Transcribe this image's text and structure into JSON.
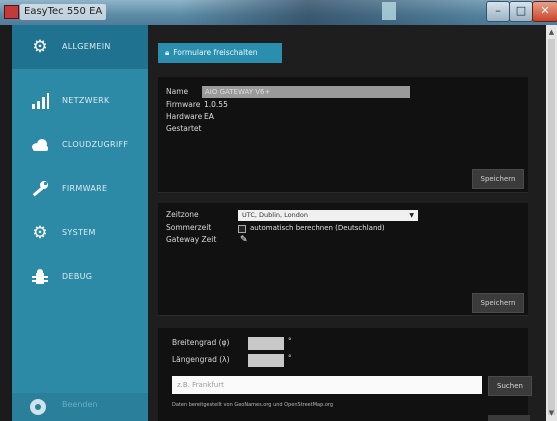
{
  "window": {
    "title": "EasyTec 550 EA"
  },
  "sidebar": {
    "items": [
      {
        "label": "ALLGEMEIN",
        "icon": "gear-icon"
      },
      {
        "label": "NETZWERK",
        "icon": "signal-icon"
      },
      {
        "label": "CLOUDZUGRIFF",
        "icon": "cloud-icon"
      },
      {
        "label": "FIRMWARE",
        "icon": "wrench-icon"
      },
      {
        "label": "SYSTEM",
        "icon": "gear-icon"
      },
      {
        "label": "DEBUG",
        "icon": "debug-icon"
      }
    ],
    "bottom_label": "Beenden"
  },
  "main": {
    "lock_button": "Formulare freischalten",
    "device": {
      "name_label": "Name",
      "name_value": "AIO GATEWAY V6+",
      "firmware_label": "Firmware",
      "firmware_value": "1.0.55",
      "hardware_label": "Hardware",
      "hardware_value": "EA",
      "started_label": "Gestartet",
      "save": "Speichern"
    },
    "time": {
      "timezone_label": "Zeitzone",
      "timezone_value": "UTC, Dublin, London",
      "dst_label": "Sommerzeit",
      "dst_option": "automatisch berechnen (Deutschland)",
      "gateway_time_label": "Gateway Zeit",
      "save": "Speichern"
    },
    "location": {
      "lat_label": "Breitengrad (φ)",
      "lon_label": "Längengrad (λ)",
      "degree": "°",
      "search_placeholder": "z.B. Frankfurt",
      "search_button": "Suchen",
      "credit": "Daten bereitgestellt von GeoNames.org und OpenStreetMap.org"
    }
  }
}
